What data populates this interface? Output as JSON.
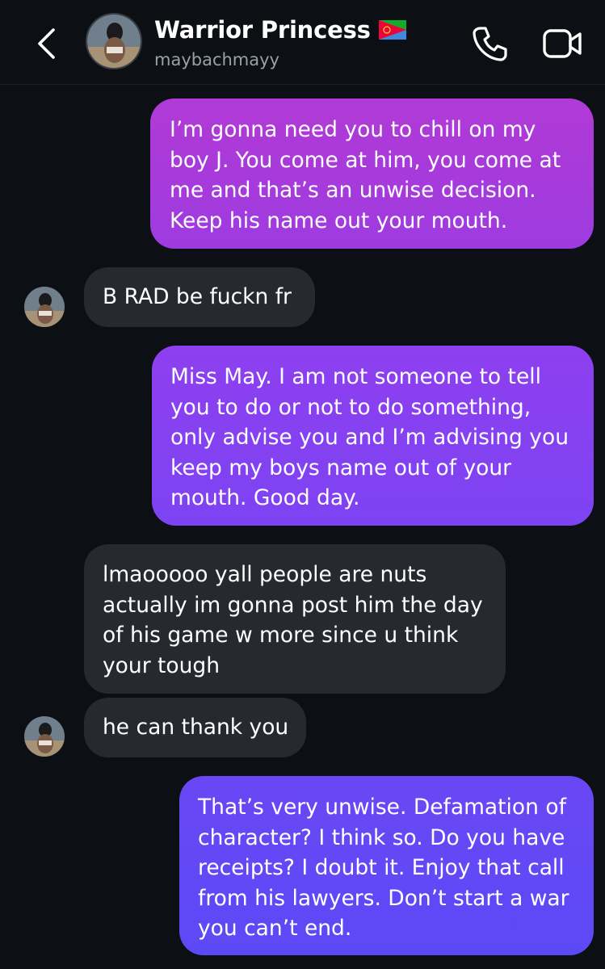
{
  "header": {
    "contact_name": "Warrior Princess",
    "username": "maybachmayy",
    "flag_icon": "eritrea-flag-icon",
    "back_icon": "chevron-left-icon",
    "call_icon": "phone-icon",
    "video_icon": "video-camera-icon"
  },
  "messages": [
    {
      "direction": "outgoing",
      "text": "I’m gonna need you to chill on my boy J. You come at him, you come at me and that’s an unwise decision. Keep his name out your mouth."
    },
    {
      "direction": "incoming",
      "text": "B RAD be fuckn fr"
    },
    {
      "direction": "outgoing",
      "text": "Miss May. I am not someone to tell you to do or not to do something, only advise you and I’m advising you keep my boys name out of your mouth. Good day."
    },
    {
      "direction": "incoming",
      "text": "lmaooooo yall people are nuts actually im gonna post him the day of his game w more since u think your tough"
    },
    {
      "direction": "incoming",
      "text": "he can thank you"
    },
    {
      "direction": "outgoing",
      "text": "That’s very unwise. Defamation of character? I think so. Do you have receipts? I doubt it. Enjoy that call from his lawyers. Don’t start a war you can’t end."
    }
  ],
  "colors": {
    "background": "#0c0f14",
    "incoming_bubble": "#26292f",
    "outgoing_top": "#b13ad6",
    "outgoing_mid": "#8e3ff0",
    "outgoing_bottom": "#5c49f6"
  }
}
